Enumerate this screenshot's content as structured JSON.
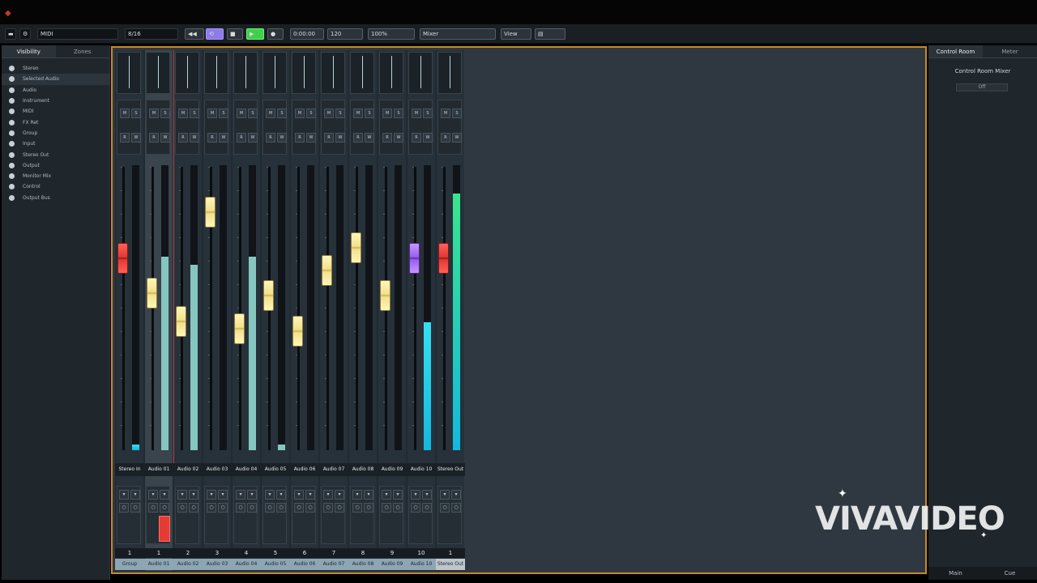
{
  "toolbar": {
    "project": "MIDI",
    "mode": "8/16",
    "time": "0:00:00",
    "tempo": "120",
    "zoom": "100%",
    "display": "Mixer",
    "view": "View"
  },
  "left_panel": {
    "tabs": [
      "Visibility",
      "Zones"
    ],
    "items": [
      "Stereo",
      "Selected Audio",
      "Audio",
      "Instrument",
      "MIDI",
      "FX Ret",
      "Group",
      "Input",
      "Stereo Out",
      "Output",
      "Monitor Mix",
      "Control",
      "Output Bus"
    ]
  },
  "channels": [
    {
      "name": "Stereo In",
      "num": "1",
      "bottom": "Group",
      "fader": 0.7,
      "meter": 0.02,
      "meter_color": "cyan",
      "fader_color": "red",
      "selected": false,
      "rec": false
    },
    {
      "name": "Audio 01",
      "num": "1",
      "bottom": "Audio 01",
      "fader": 0.56,
      "meter": 0.68,
      "meter_color": "aqua",
      "fader_color": "yellow",
      "selected": true,
      "rec": true
    },
    {
      "name": "Audio 02",
      "num": "2",
      "bottom": "Audio 02",
      "fader": 0.45,
      "meter": 0.65,
      "meter_color": "aqua",
      "fader_color": "yellow",
      "selected": false,
      "rec": false
    },
    {
      "name": "Audio 03",
      "num": "3",
      "bottom": "Audio 03",
      "fader": 0.88,
      "meter": 0.0,
      "meter_color": "aqua",
      "fader_color": "yellow",
      "selected": false,
      "rec": false
    },
    {
      "name": "Audio 04",
      "num": "4",
      "bottom": "Audio 04",
      "fader": 0.42,
      "meter": 0.68,
      "meter_color": "aqua",
      "fader_color": "yellow",
      "selected": false,
      "rec": false
    },
    {
      "name": "Audio 05",
      "num": "5",
      "bottom": "Audio 05",
      "fader": 0.55,
      "meter": 0.02,
      "meter_color": "aqua",
      "fader_color": "yellow",
      "selected": false,
      "rec": false
    },
    {
      "name": "Audio 06",
      "num": "6",
      "bottom": "Audio 06",
      "fader": 0.41,
      "meter": 0.0,
      "meter_color": "aqua",
      "fader_color": "yellow",
      "selected": false,
      "rec": false
    },
    {
      "name": "Audio 07",
      "num": "7",
      "bottom": "Audio 07",
      "fader": 0.65,
      "meter": 0.0,
      "meter_color": "aqua",
      "fader_color": "yellow",
      "selected": false,
      "rec": false
    },
    {
      "name": "Audio 08",
      "num": "8",
      "bottom": "Audio 08",
      "fader": 0.74,
      "meter": 0.0,
      "meter_color": "aqua",
      "fader_color": "yellow",
      "selected": false,
      "rec": false
    },
    {
      "name": "Audio 09",
      "num": "9",
      "bottom": "Audio 09",
      "fader": 0.55,
      "meter": 0.0,
      "meter_color": "aqua",
      "fader_color": "yellow",
      "selected": false,
      "rec": false
    },
    {
      "name": "Audio 10",
      "num": "10",
      "bottom": "Audio 10",
      "fader": 0.7,
      "meter": 0.45,
      "meter_color": "cyan",
      "fader_color": "purple",
      "selected": false,
      "rec": false
    },
    {
      "name": "Stereo Out",
      "num": "1",
      "bottom": "Stereo Out",
      "fader": 0.7,
      "meter": 0.9,
      "meter_color": "green",
      "fader_color": "red",
      "selected": false,
      "rec": false
    }
  ],
  "right_panel": {
    "tabs": [
      "Control Room",
      "Meter"
    ],
    "title": "Control Room Mixer",
    "field": "Off",
    "bottom": [
      "Main",
      "Cue"
    ]
  },
  "watermark": "VIVAVIDEO",
  "colors": {
    "accent": "#c78a2a",
    "record": "#e43b33",
    "meter": "#86c6c0"
  }
}
